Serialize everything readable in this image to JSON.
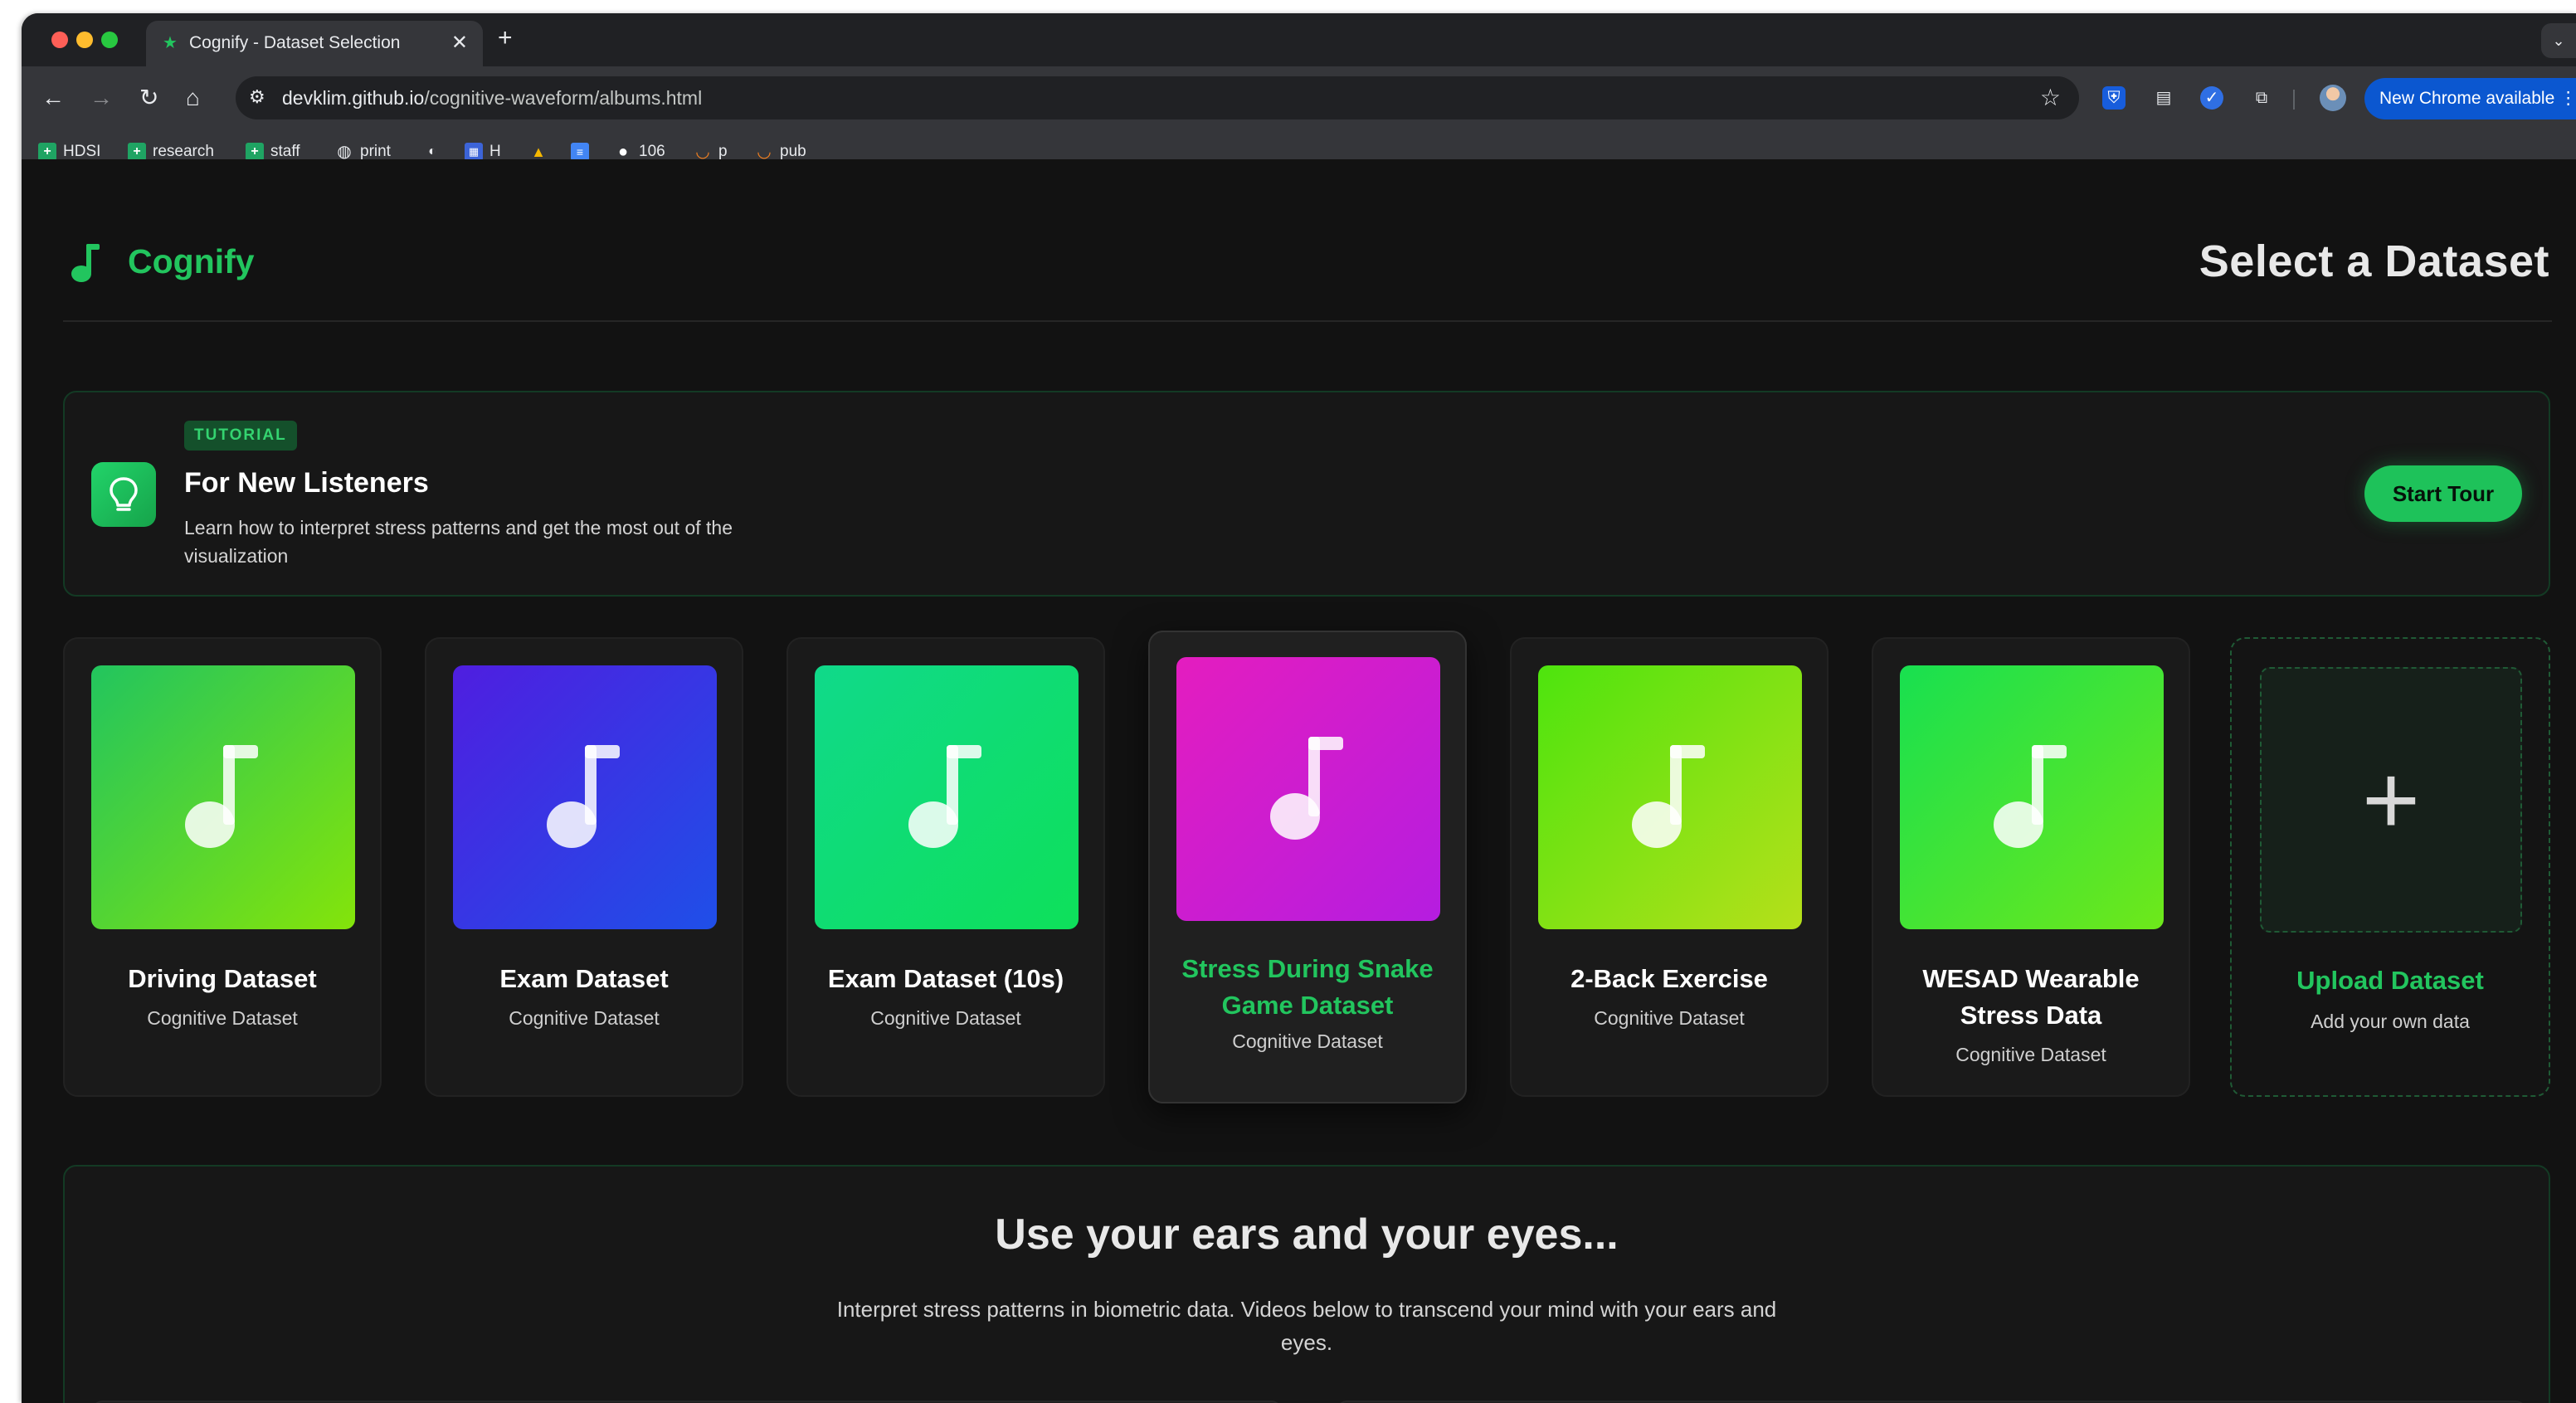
{
  "browser": {
    "tab_title": "Cognify - Dataset Selection",
    "tab_close": "✕",
    "new_tab": "+",
    "url_host": "devklim.github.io",
    "url_path": "/cognitive-waveform/albums.html",
    "update_label": "New Chrome available",
    "bookmarks": [
      {
        "label": "HDSI",
        "icon": "sheets-icon"
      },
      {
        "label": "research",
        "icon": "sheets-icon"
      },
      {
        "label": "staff",
        "icon": "sheets-icon"
      },
      {
        "label": "print",
        "icon": "globe-icon"
      },
      {
        "label": "",
        "icon": "shield-icon"
      },
      {
        "label": "H",
        "icon": "grid-icon"
      },
      {
        "label": "",
        "icon": "drive-icon"
      },
      {
        "label": "",
        "icon": "docs-icon"
      },
      {
        "label": "106",
        "icon": "github-icon"
      },
      {
        "label": "p",
        "icon": "arc-icon"
      },
      {
        "label": "pub",
        "icon": "arc-icon"
      }
    ]
  },
  "header": {
    "brand": "Cognify",
    "title": "Select a Dataset"
  },
  "tutorial": {
    "badge": "TUTORIAL",
    "title": "For New Listeners",
    "description": "Learn how to interpret stress patterns and get the most out of the visualization",
    "button": "Start Tour"
  },
  "datasets": [
    {
      "title": "Driving Dataset",
      "subtitle": "Cognitive Dataset",
      "gradient": [
        "#22c55e",
        "#84e40a"
      ]
    },
    {
      "title": "Exam Dataset",
      "subtitle": "Cognitive Dataset",
      "gradient": [
        "#4f1ee0",
        "#1f4fe8"
      ]
    },
    {
      "title": "Exam Dataset (10s)",
      "subtitle": "Cognitive Dataset",
      "gradient": [
        "#10d98a",
        "#0ee05a"
      ]
    },
    {
      "title": "Stress During Snake Game Dataset",
      "subtitle": "Cognitive Dataset",
      "gradient": [
        "#e41dbf",
        "#b51de0"
      ]
    },
    {
      "title": "2-Back Exercise",
      "subtitle": "Cognitive Dataset",
      "gradient": [
        "#4de40e",
        "#b6e01a"
      ]
    },
    {
      "title": "WESAD Wearable Stress Data",
      "subtitle": "Cognitive Dataset",
      "gradient": [
        "#18e050",
        "#6ee81a"
      ]
    }
  ],
  "upload": {
    "title": "Upload Dataset",
    "subtitle": "Add your own data",
    "icon": "+"
  },
  "learn": {
    "title": "Use your ears and your eyes...",
    "description": "Interpret stress patterns in biometric data. Videos below to transcend your mind with your ears and eyes."
  },
  "colors": {
    "accent": "#22c55e",
    "background": "#121212",
    "card": "#1a1a1a"
  }
}
